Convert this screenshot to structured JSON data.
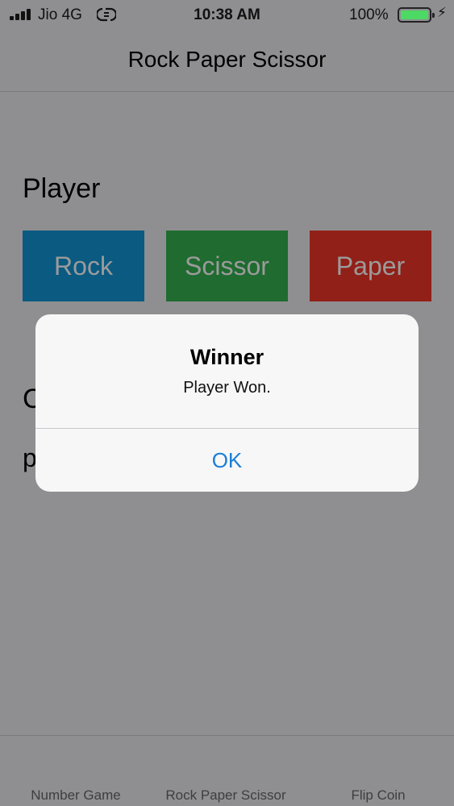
{
  "status_bar": {
    "carrier": "Jio 4G",
    "time": "10:38 AM",
    "battery_percent": "100%",
    "battery_level": 1.0,
    "battery_color": "#4cd964"
  },
  "nav": {
    "title": "Rock Paper Scissor"
  },
  "player": {
    "heading": "Player",
    "buttons": [
      {
        "label": "Rock",
        "color": "#0a5a82"
      },
      {
        "label": "Scissor",
        "color": "#1f6b30"
      },
      {
        "label": "Paper",
        "color": "#912018"
      }
    ]
  },
  "computer": {
    "heading_visible": "C",
    "choice_visible": "p"
  },
  "alert": {
    "title": "Winner",
    "message": "Player Won.",
    "ok_label": "OK",
    "ok_color": "#1a7ed6"
  },
  "tabs": [
    {
      "label": "Number Game"
    },
    {
      "label": "Rock Paper Scissor"
    },
    {
      "label": "Flip Coin"
    }
  ]
}
